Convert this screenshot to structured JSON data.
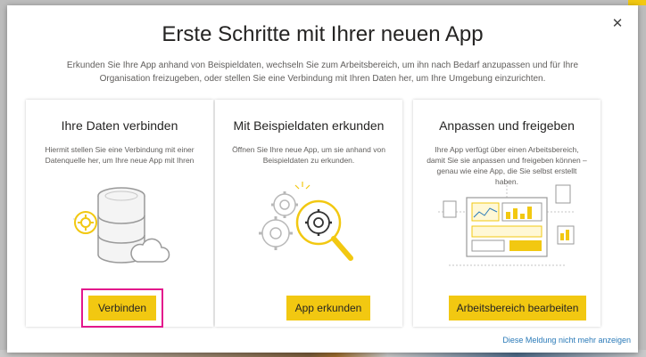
{
  "dialog": {
    "title": "Erste Schritte mit Ihrer neuen App",
    "subtitle": "Erkunden Sie Ihre App anhand von Beispieldaten, wechseln Sie zum Arbeitsbereich, um ihn nach Bedarf anzupassen und für Ihre Organisation freizugeben, oder stellen Sie eine Verbindung mit Ihren Daten her, um Ihre Umgebung einzurichten.",
    "close_icon": "close-icon",
    "dismiss_link": "Diese Meldung nicht mehr anzeigen"
  },
  "cards": [
    {
      "title": "Ihre Daten verbinden",
      "description": "Hiermit stellen Sie eine Verbindung mit einer Datenquelle her, um Ihre neue App mit Ihren",
      "button": "Verbinden",
      "icon": "database-cloud-icon"
    },
    {
      "title": "Mit Beispieldaten erkunden",
      "description": "Öffnen Sie Ihre neue App, um sie anhand von Beispieldaten zu erkunden.",
      "button": "App erkunden",
      "icon": "gears-magnifier-icon"
    },
    {
      "title": "Anpassen und freigeben",
      "description": "Ihre App verfügt über einen Arbeitsbereich, damit Sie sie anpassen und freigeben können – genau wie eine App, die Sie selbst erstellt haben.",
      "button": "Arbeitsbereich bearbeiten",
      "icon": "dashboard-icon"
    }
  ],
  "colors": {
    "accent": "#f2c811",
    "highlight": "#e3178c",
    "link": "#2a7ab8"
  }
}
